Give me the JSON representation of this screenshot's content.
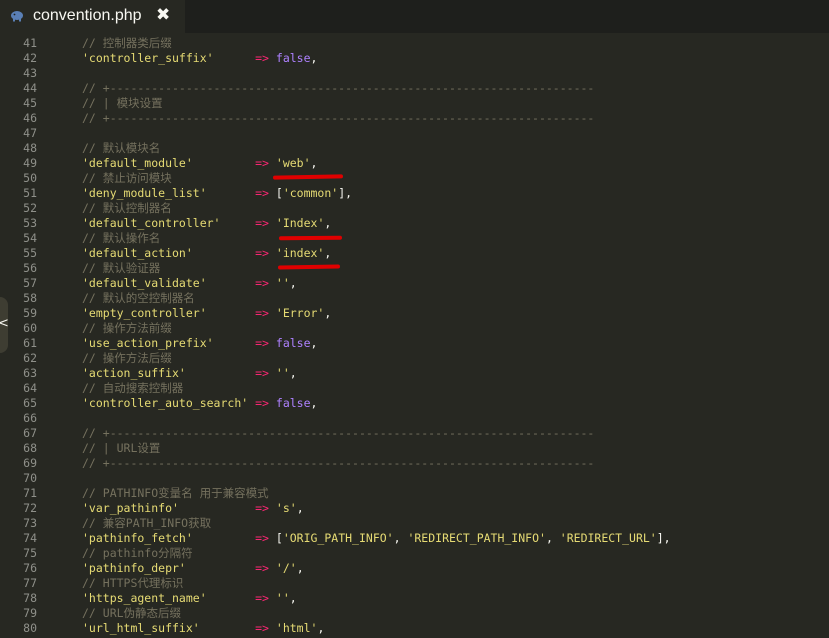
{
  "tab": {
    "title": "convention.php",
    "close_glyph": "✖",
    "icon": "php-elephant-icon"
  },
  "side_handle": {
    "glyph": "<"
  },
  "colors": {
    "background": "#272822",
    "comment": "#75715e",
    "string": "#e6db74",
    "operator": "#f92672",
    "constant": "#ae81ff",
    "annotation": "#e00000"
  },
  "lines": [
    {
      "n": "41",
      "t": [
        {
          "c": "cm",
          "v": "// 控制器类后缀"
        }
      ]
    },
    {
      "n": "42",
      "t": [
        {
          "c": "str",
          "v": "'controller_suffix'"
        },
        {
          "c": "pu",
          "v": "      "
        },
        {
          "c": "op",
          "v": "=>"
        },
        {
          "c": "pu",
          "v": " "
        },
        {
          "c": "kw",
          "v": "false"
        },
        {
          "c": "pu",
          "v": ","
        }
      ]
    },
    {
      "n": "43",
      "t": []
    },
    {
      "n": "44",
      "t": [
        {
          "c": "cm",
          "v": "// +----------------------------------------------------------------------"
        }
      ]
    },
    {
      "n": "45",
      "t": [
        {
          "c": "cm",
          "v": "// | 模块设置"
        }
      ]
    },
    {
      "n": "46",
      "t": [
        {
          "c": "cm",
          "v": "// +----------------------------------------------------------------------"
        }
      ]
    },
    {
      "n": "47",
      "t": []
    },
    {
      "n": "48",
      "t": [
        {
          "c": "cm",
          "v": "// 默认模块名"
        }
      ]
    },
    {
      "n": "49",
      "t": [
        {
          "c": "str",
          "v": "'default_module'"
        },
        {
          "c": "pu",
          "v": "         "
        },
        {
          "c": "op",
          "v": "=>"
        },
        {
          "c": "pu",
          "v": " "
        },
        {
          "c": "str",
          "v": "'web'"
        },
        {
          "c": "pu",
          "v": ","
        }
      ]
    },
    {
      "n": "50",
      "t": [
        {
          "c": "cm",
          "v": "// 禁止访问模块"
        }
      ]
    },
    {
      "n": "51",
      "t": [
        {
          "c": "str",
          "v": "'deny_module_list'"
        },
        {
          "c": "pu",
          "v": "       "
        },
        {
          "c": "op",
          "v": "=>"
        },
        {
          "c": "pu",
          "v": " ["
        },
        {
          "c": "str",
          "v": "'common'"
        },
        {
          "c": "pu",
          "v": "],"
        }
      ]
    },
    {
      "n": "52",
      "t": [
        {
          "c": "cm",
          "v": "// 默认控制器名"
        }
      ]
    },
    {
      "n": "53",
      "t": [
        {
          "c": "str",
          "v": "'default_controller'"
        },
        {
          "c": "pu",
          "v": "     "
        },
        {
          "c": "op",
          "v": "=>"
        },
        {
          "c": "pu",
          "v": " "
        },
        {
          "c": "str",
          "v": "'Index'"
        },
        {
          "c": "pu",
          "v": ","
        }
      ]
    },
    {
      "n": "54",
      "t": [
        {
          "c": "cm",
          "v": "// 默认操作名"
        }
      ]
    },
    {
      "n": "55",
      "t": [
        {
          "c": "str",
          "v": "'default_action'"
        },
        {
          "c": "pu",
          "v": "         "
        },
        {
          "c": "op",
          "v": "=>"
        },
        {
          "c": "pu",
          "v": " "
        },
        {
          "c": "str",
          "v": "'index'"
        },
        {
          "c": "pu",
          "v": ","
        }
      ]
    },
    {
      "n": "56",
      "t": [
        {
          "c": "cm",
          "v": "// 默认验证器"
        }
      ]
    },
    {
      "n": "57",
      "t": [
        {
          "c": "str",
          "v": "'default_validate'"
        },
        {
          "c": "pu",
          "v": "       "
        },
        {
          "c": "op",
          "v": "=>"
        },
        {
          "c": "pu",
          "v": " "
        },
        {
          "c": "str",
          "v": "''"
        },
        {
          "c": "pu",
          "v": ","
        }
      ]
    },
    {
      "n": "58",
      "t": [
        {
          "c": "cm",
          "v": "// 默认的空控制器名"
        }
      ]
    },
    {
      "n": "59",
      "t": [
        {
          "c": "str",
          "v": "'empty_controller'"
        },
        {
          "c": "pu",
          "v": "       "
        },
        {
          "c": "op",
          "v": "=>"
        },
        {
          "c": "pu",
          "v": " "
        },
        {
          "c": "str",
          "v": "'Error'"
        },
        {
          "c": "pu",
          "v": ","
        }
      ]
    },
    {
      "n": "60",
      "t": [
        {
          "c": "cm",
          "v": "// 操作方法前缀"
        }
      ]
    },
    {
      "n": "61",
      "t": [
        {
          "c": "str",
          "v": "'use_action_prefix'"
        },
        {
          "c": "pu",
          "v": "      "
        },
        {
          "c": "op",
          "v": "=>"
        },
        {
          "c": "pu",
          "v": " "
        },
        {
          "c": "kw",
          "v": "false"
        },
        {
          "c": "pu",
          "v": ","
        }
      ]
    },
    {
      "n": "62",
      "t": [
        {
          "c": "cm",
          "v": "// 操作方法后缀"
        }
      ]
    },
    {
      "n": "63",
      "t": [
        {
          "c": "str",
          "v": "'action_suffix'"
        },
        {
          "c": "pu",
          "v": "          "
        },
        {
          "c": "op",
          "v": "=>"
        },
        {
          "c": "pu",
          "v": " "
        },
        {
          "c": "str",
          "v": "''"
        },
        {
          "c": "pu",
          "v": ","
        }
      ]
    },
    {
      "n": "64",
      "t": [
        {
          "c": "cm",
          "v": "// 自动搜索控制器"
        }
      ]
    },
    {
      "n": "65",
      "t": [
        {
          "c": "str",
          "v": "'controller_auto_search'"
        },
        {
          "c": "pu",
          "v": " "
        },
        {
          "c": "op",
          "v": "=>"
        },
        {
          "c": "pu",
          "v": " "
        },
        {
          "c": "kw",
          "v": "false"
        },
        {
          "c": "pu",
          "v": ","
        }
      ]
    },
    {
      "n": "66",
      "t": []
    },
    {
      "n": "67",
      "t": [
        {
          "c": "cm",
          "v": "// +----------------------------------------------------------------------"
        }
      ]
    },
    {
      "n": "68",
      "t": [
        {
          "c": "cm",
          "v": "// | URL设置"
        }
      ]
    },
    {
      "n": "69",
      "t": [
        {
          "c": "cm",
          "v": "// +----------------------------------------------------------------------"
        }
      ]
    },
    {
      "n": "70",
      "t": []
    },
    {
      "n": "71",
      "t": [
        {
          "c": "cm",
          "v": "// PATHINFO变量名 用于兼容模式"
        }
      ]
    },
    {
      "n": "72",
      "t": [
        {
          "c": "str",
          "v": "'var_pathinfo'"
        },
        {
          "c": "pu",
          "v": "           "
        },
        {
          "c": "op",
          "v": "=>"
        },
        {
          "c": "pu",
          "v": " "
        },
        {
          "c": "str",
          "v": "'s'"
        },
        {
          "c": "pu",
          "v": ","
        }
      ]
    },
    {
      "n": "73",
      "t": [
        {
          "c": "cm",
          "v": "// 兼容PATH_INFO获取"
        }
      ]
    },
    {
      "n": "74",
      "t": [
        {
          "c": "str",
          "v": "'pathinfo_fetch'"
        },
        {
          "c": "pu",
          "v": "         "
        },
        {
          "c": "op",
          "v": "=>"
        },
        {
          "c": "pu",
          "v": " ["
        },
        {
          "c": "str",
          "v": "'ORIG_PATH_INFO'"
        },
        {
          "c": "pu",
          "v": ", "
        },
        {
          "c": "str",
          "v": "'REDIRECT_PATH_INFO'"
        },
        {
          "c": "pu",
          "v": ", "
        },
        {
          "c": "str",
          "v": "'REDIRECT_URL'"
        },
        {
          "c": "pu",
          "v": "],"
        }
      ]
    },
    {
      "n": "75",
      "t": [
        {
          "c": "cm",
          "v": "// pathinfo分隔符"
        }
      ]
    },
    {
      "n": "76",
      "t": [
        {
          "c": "str",
          "v": "'pathinfo_depr'"
        },
        {
          "c": "pu",
          "v": "          "
        },
        {
          "c": "op",
          "v": "=>"
        },
        {
          "c": "pu",
          "v": " "
        },
        {
          "c": "str",
          "v": "'/'"
        },
        {
          "c": "pu",
          "v": ","
        }
      ]
    },
    {
      "n": "77",
      "t": [
        {
          "c": "cm",
          "v": "// HTTPS代理标识"
        }
      ]
    },
    {
      "n": "78",
      "t": [
        {
          "c": "str",
          "v": "'https_agent_name'"
        },
        {
          "c": "pu",
          "v": "       "
        },
        {
          "c": "op",
          "v": "=>"
        },
        {
          "c": "pu",
          "v": " "
        },
        {
          "c": "str",
          "v": "''"
        },
        {
          "c": "pu",
          "v": ","
        }
      ]
    },
    {
      "n": "79",
      "t": [
        {
          "c": "cm",
          "v": "// URL伪静态后缀"
        }
      ]
    },
    {
      "n": "80",
      "t": [
        {
          "c": "str",
          "v": "'url_html_suffix'"
        },
        {
          "c": "pu",
          "v": "        "
        },
        {
          "c": "op",
          "v": "=>"
        },
        {
          "c": "pu",
          "v": " "
        },
        {
          "c": "str",
          "v": "'html'"
        },
        {
          "c": "pu",
          "v": ","
        }
      ]
    }
  ]
}
